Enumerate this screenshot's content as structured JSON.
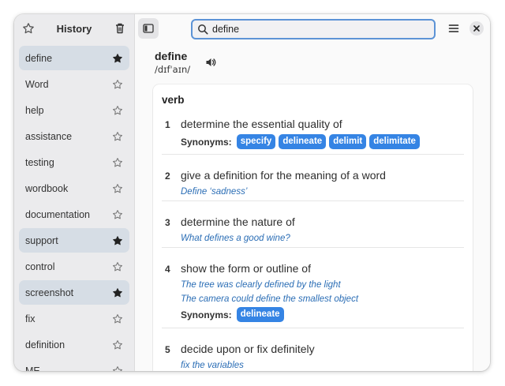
{
  "sidebar": {
    "title": "History",
    "items": [
      {
        "label": "define",
        "favorite": true
      },
      {
        "label": "Word",
        "favorite": false
      },
      {
        "label": "help",
        "favorite": false
      },
      {
        "label": "assistance",
        "favorite": false
      },
      {
        "label": "testing",
        "favorite": false
      },
      {
        "label": "wordbook",
        "favorite": false
      },
      {
        "label": "documentation",
        "favorite": false
      },
      {
        "label": "support",
        "favorite": true
      },
      {
        "label": "control",
        "favorite": false
      },
      {
        "label": "screenshot",
        "favorite": true
      },
      {
        "label": "fix",
        "favorite": false
      },
      {
        "label": "definition",
        "favorite": false
      },
      {
        "label": "ME",
        "favorite": false
      }
    ]
  },
  "search": {
    "value": "define"
  },
  "entry": {
    "word": "define",
    "pronunciation": "/dɪfˈaɪn/",
    "pos": "verb",
    "synonyms_label": "Synonyms:",
    "senses": [
      {
        "num": "1",
        "def": "determine the essential quality of",
        "examples": [],
        "synonyms": [
          "specify",
          "delineate",
          "delimit",
          "delimitate"
        ]
      },
      {
        "num": "2",
        "def": "give a definition for the meaning of a word",
        "examples": [
          "Define ‘sadness’"
        ],
        "synonyms": []
      },
      {
        "num": "3",
        "def": "determine the nature of",
        "examples": [
          "What defines a good wine?"
        ],
        "synonyms": []
      },
      {
        "num": "4",
        "def": "show the form or outline of",
        "examples": [
          "The tree was clearly defined by the light",
          "The camera could define the smallest object"
        ],
        "synonyms": [
          "delineate"
        ]
      },
      {
        "num": "5",
        "def": "decide upon or fix definitely",
        "examples": [
          "fix the variables"
        ],
        "synonyms": []
      }
    ]
  },
  "icons": {
    "accent": "#3584e4",
    "example_color": "#2a6db5"
  }
}
